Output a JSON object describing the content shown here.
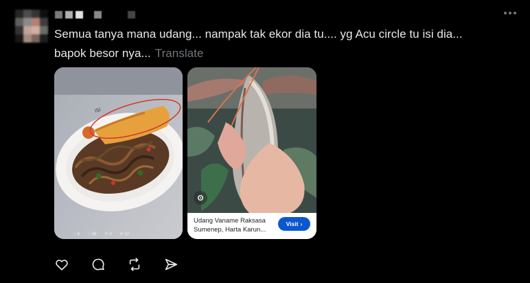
{
  "post": {
    "text_line1": "Semua tanya mana udang... nampak tak ekor dia tu.... yg Acu circle tu isi dia...",
    "text_line2": "bapok besor nya...",
    "translate_label": "Translate"
  },
  "media": {
    "left_image": {
      "label": "plate-of-fried-noodles-with-prawn",
      "handwriting": "ISI",
      "stats": [
        "5",
        "10",
        "3",
        "17"
      ]
    },
    "right_image": {
      "label": "hand-holding-large-prawn",
      "ad_title": "Udang Vaname Raksasa Sumenep, Harta Karun...",
      "visit_label": "Visit"
    }
  },
  "actions": [
    "reply-icon",
    "retweet-icon",
    "like-icon",
    "share-icon"
  ],
  "colors": {
    "background": "#000000",
    "text": "#e7e9ea",
    "muted": "#71767b",
    "visit_button": "#0b57d0"
  }
}
